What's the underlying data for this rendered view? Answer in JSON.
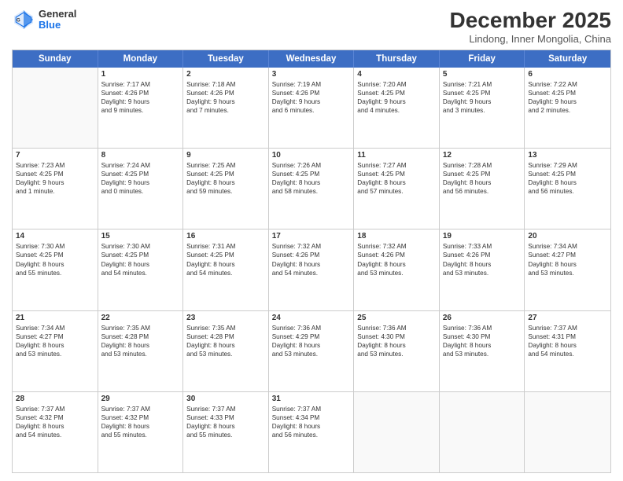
{
  "header": {
    "logo_general": "General",
    "logo_blue": "Blue",
    "month_title": "December 2025",
    "location": "Lindong, Inner Mongolia, China"
  },
  "weekdays": [
    "Sunday",
    "Monday",
    "Tuesday",
    "Wednesday",
    "Thursday",
    "Friday",
    "Saturday"
  ],
  "rows": [
    [
      {
        "day": "",
        "lines": []
      },
      {
        "day": "1",
        "lines": [
          "Sunrise: 7:17 AM",
          "Sunset: 4:26 PM",
          "Daylight: 9 hours",
          "and 9 minutes."
        ]
      },
      {
        "day": "2",
        "lines": [
          "Sunrise: 7:18 AM",
          "Sunset: 4:26 PM",
          "Daylight: 9 hours",
          "and 7 minutes."
        ]
      },
      {
        "day": "3",
        "lines": [
          "Sunrise: 7:19 AM",
          "Sunset: 4:26 PM",
          "Daylight: 9 hours",
          "and 6 minutes."
        ]
      },
      {
        "day": "4",
        "lines": [
          "Sunrise: 7:20 AM",
          "Sunset: 4:25 PM",
          "Daylight: 9 hours",
          "and 4 minutes."
        ]
      },
      {
        "day": "5",
        "lines": [
          "Sunrise: 7:21 AM",
          "Sunset: 4:25 PM",
          "Daylight: 9 hours",
          "and 3 minutes."
        ]
      },
      {
        "day": "6",
        "lines": [
          "Sunrise: 7:22 AM",
          "Sunset: 4:25 PM",
          "Daylight: 9 hours",
          "and 2 minutes."
        ]
      }
    ],
    [
      {
        "day": "7",
        "lines": [
          "Sunrise: 7:23 AM",
          "Sunset: 4:25 PM",
          "Daylight: 9 hours",
          "and 1 minute."
        ]
      },
      {
        "day": "8",
        "lines": [
          "Sunrise: 7:24 AM",
          "Sunset: 4:25 PM",
          "Daylight: 9 hours",
          "and 0 minutes."
        ]
      },
      {
        "day": "9",
        "lines": [
          "Sunrise: 7:25 AM",
          "Sunset: 4:25 PM",
          "Daylight: 8 hours",
          "and 59 minutes."
        ]
      },
      {
        "day": "10",
        "lines": [
          "Sunrise: 7:26 AM",
          "Sunset: 4:25 PM",
          "Daylight: 8 hours",
          "and 58 minutes."
        ]
      },
      {
        "day": "11",
        "lines": [
          "Sunrise: 7:27 AM",
          "Sunset: 4:25 PM",
          "Daylight: 8 hours",
          "and 57 minutes."
        ]
      },
      {
        "day": "12",
        "lines": [
          "Sunrise: 7:28 AM",
          "Sunset: 4:25 PM",
          "Daylight: 8 hours",
          "and 56 minutes."
        ]
      },
      {
        "day": "13",
        "lines": [
          "Sunrise: 7:29 AM",
          "Sunset: 4:25 PM",
          "Daylight: 8 hours",
          "and 56 minutes."
        ]
      }
    ],
    [
      {
        "day": "14",
        "lines": [
          "Sunrise: 7:30 AM",
          "Sunset: 4:25 PM",
          "Daylight: 8 hours",
          "and 55 minutes."
        ]
      },
      {
        "day": "15",
        "lines": [
          "Sunrise: 7:30 AM",
          "Sunset: 4:25 PM",
          "Daylight: 8 hours",
          "and 54 minutes."
        ]
      },
      {
        "day": "16",
        "lines": [
          "Sunrise: 7:31 AM",
          "Sunset: 4:25 PM",
          "Daylight: 8 hours",
          "and 54 minutes."
        ]
      },
      {
        "day": "17",
        "lines": [
          "Sunrise: 7:32 AM",
          "Sunset: 4:26 PM",
          "Daylight: 8 hours",
          "and 54 minutes."
        ]
      },
      {
        "day": "18",
        "lines": [
          "Sunrise: 7:32 AM",
          "Sunset: 4:26 PM",
          "Daylight: 8 hours",
          "and 53 minutes."
        ]
      },
      {
        "day": "19",
        "lines": [
          "Sunrise: 7:33 AM",
          "Sunset: 4:26 PM",
          "Daylight: 8 hours",
          "and 53 minutes."
        ]
      },
      {
        "day": "20",
        "lines": [
          "Sunrise: 7:34 AM",
          "Sunset: 4:27 PM",
          "Daylight: 8 hours",
          "and 53 minutes."
        ]
      }
    ],
    [
      {
        "day": "21",
        "lines": [
          "Sunrise: 7:34 AM",
          "Sunset: 4:27 PM",
          "Daylight: 8 hours",
          "and 53 minutes."
        ]
      },
      {
        "day": "22",
        "lines": [
          "Sunrise: 7:35 AM",
          "Sunset: 4:28 PM",
          "Daylight: 8 hours",
          "and 53 minutes."
        ]
      },
      {
        "day": "23",
        "lines": [
          "Sunrise: 7:35 AM",
          "Sunset: 4:28 PM",
          "Daylight: 8 hours",
          "and 53 minutes."
        ]
      },
      {
        "day": "24",
        "lines": [
          "Sunrise: 7:36 AM",
          "Sunset: 4:29 PM",
          "Daylight: 8 hours",
          "and 53 minutes."
        ]
      },
      {
        "day": "25",
        "lines": [
          "Sunrise: 7:36 AM",
          "Sunset: 4:30 PM",
          "Daylight: 8 hours",
          "and 53 minutes."
        ]
      },
      {
        "day": "26",
        "lines": [
          "Sunrise: 7:36 AM",
          "Sunset: 4:30 PM",
          "Daylight: 8 hours",
          "and 53 minutes."
        ]
      },
      {
        "day": "27",
        "lines": [
          "Sunrise: 7:37 AM",
          "Sunset: 4:31 PM",
          "Daylight: 8 hours",
          "and 54 minutes."
        ]
      }
    ],
    [
      {
        "day": "28",
        "lines": [
          "Sunrise: 7:37 AM",
          "Sunset: 4:32 PM",
          "Daylight: 8 hours",
          "and 54 minutes."
        ]
      },
      {
        "day": "29",
        "lines": [
          "Sunrise: 7:37 AM",
          "Sunset: 4:32 PM",
          "Daylight: 8 hours",
          "and 55 minutes."
        ]
      },
      {
        "day": "30",
        "lines": [
          "Sunrise: 7:37 AM",
          "Sunset: 4:33 PM",
          "Daylight: 8 hours",
          "and 55 minutes."
        ]
      },
      {
        "day": "31",
        "lines": [
          "Sunrise: 7:37 AM",
          "Sunset: 4:34 PM",
          "Daylight: 8 hours",
          "and 56 minutes."
        ]
      },
      {
        "day": "",
        "lines": []
      },
      {
        "day": "",
        "lines": []
      },
      {
        "day": "",
        "lines": []
      }
    ]
  ]
}
